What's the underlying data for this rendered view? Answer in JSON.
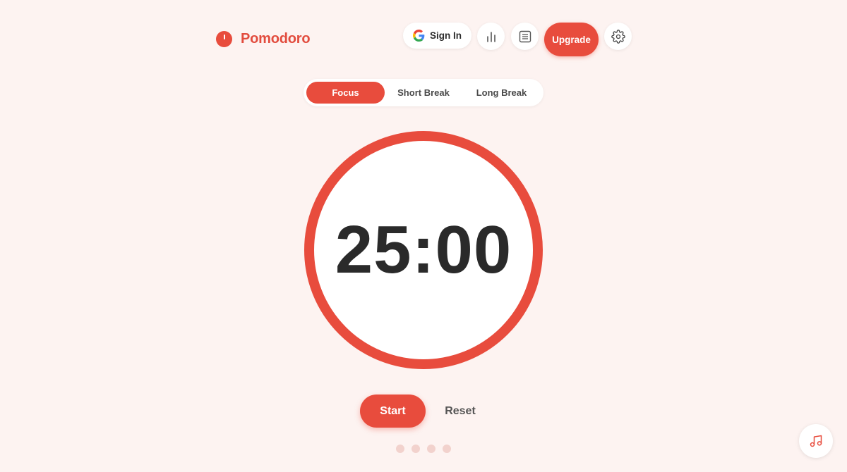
{
  "brand": {
    "name": "Pomodoro",
    "logo_icon": "tomato-icon",
    "color": "#e24c3e"
  },
  "header": {
    "signin": {
      "label": "Sign In",
      "icon": "google-icon"
    },
    "stats_button": {
      "icon": "bar-chart-icon"
    },
    "tasks_button": {
      "icon": "list-icon"
    },
    "upgrade": {
      "label": "Upgrade"
    },
    "settings_button": {
      "icon": "gear-icon"
    }
  },
  "modes": {
    "active": "Focus",
    "tabs": [
      {
        "label": "Focus"
      },
      {
        "label": "Short Break"
      },
      {
        "label": "Long Break"
      }
    ]
  },
  "timer": {
    "display": "25:00",
    "progress": 1.0
  },
  "controls": {
    "start_label": "Start",
    "reset_label": "Reset"
  },
  "session_dots": {
    "total": 4,
    "completed": 0
  },
  "music_button": {
    "icon": "music-note-icon"
  },
  "colors": {
    "accent": "#e84c3d",
    "background": "#fdf3f1",
    "timer_text": "#2a2a2a",
    "dot_inactive": "#f2d2cd"
  }
}
